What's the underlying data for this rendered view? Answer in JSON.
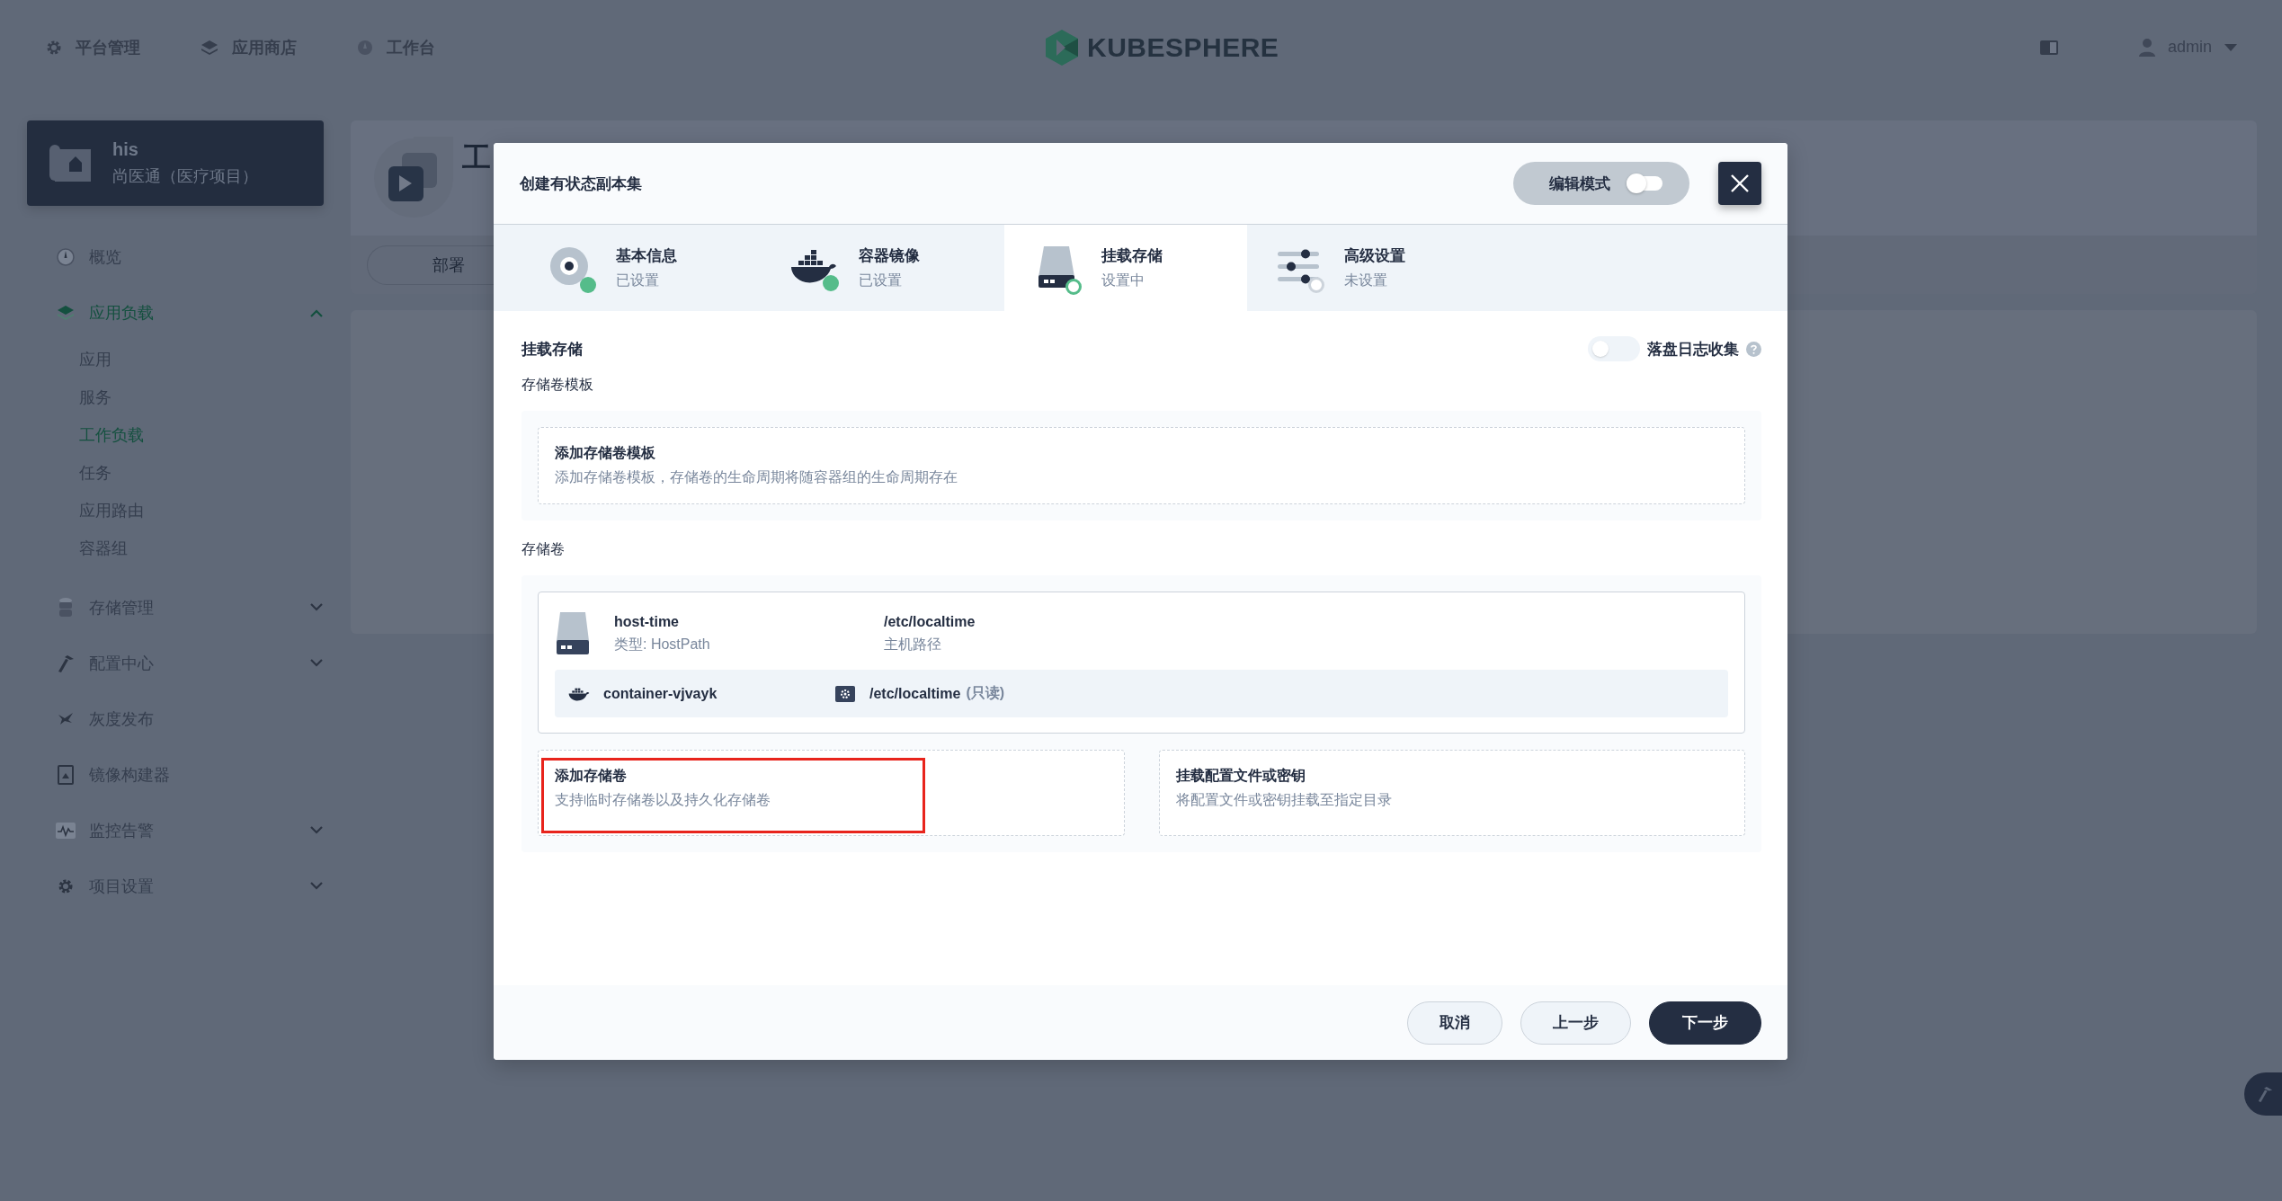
{
  "topbar": {
    "nav": [
      {
        "label": "平台管理"
      },
      {
        "label": "应用商店"
      },
      {
        "label": "工作台"
      }
    ],
    "logo": "KUBESPHERE",
    "user": "admin"
  },
  "project": {
    "name": "his",
    "description": "尚医通（医疗项目）"
  },
  "sidebar": {
    "items": [
      {
        "label": "概览",
        "kind": "link",
        "selected": false
      },
      {
        "label": "应用负载",
        "kind": "group",
        "expanded": true,
        "selected": true,
        "children": [
          {
            "label": "应用",
            "selected": false
          },
          {
            "label": "服务",
            "selected": false
          },
          {
            "label": "工作负载",
            "selected": true
          },
          {
            "label": "任务",
            "selected": false
          },
          {
            "label": "应用路由",
            "selected": false
          },
          {
            "label": "容器组",
            "selected": false
          }
        ]
      },
      {
        "label": "存储管理",
        "kind": "group",
        "expanded": false,
        "selected": false
      },
      {
        "label": "配置中心",
        "kind": "group",
        "expanded": false,
        "selected": false
      },
      {
        "label": "灰度发布",
        "kind": "link",
        "selected": false
      },
      {
        "label": "镜像构建器",
        "kind": "link",
        "selected": false
      },
      {
        "label": "监控告警",
        "kind": "group",
        "expanded": false,
        "selected": false
      },
      {
        "label": "项目设置",
        "kind": "group",
        "expanded": false,
        "selected": false
      }
    ]
  },
  "background": {
    "title": "工",
    "tab": "部署"
  },
  "dialog": {
    "title": "创建有状态副本集",
    "edit_mode": {
      "label": "编辑模式",
      "on": false
    },
    "steps": [
      {
        "title": "基本信息",
        "status": "已设置",
        "selected": false
      },
      {
        "title": "容器镜像",
        "status": "已设置",
        "selected": false
      },
      {
        "title": "挂载存储",
        "status": "设置中",
        "selected": true
      },
      {
        "title": "高级设置",
        "status": "未设置",
        "selected": false
      }
    ],
    "section_title": "挂载存储",
    "log_collection": {
      "label": "落盘日志收集",
      "on": false
    },
    "template_label": "存储卷模板",
    "template_card": {
      "title": "添加存储卷模板",
      "description": "添加存储卷模板，存储卷的生命周期将随容器组的生命周期存在"
    },
    "volumes_label": "存储卷",
    "volumes": [
      {
        "name": "host-time",
        "type": "类型: HostPath",
        "path": "/etc/localtime",
        "path_label": "主机路径",
        "mounts": [
          {
            "container": "container-vjvayk",
            "mount_path": "/etc/localtime",
            "mode": "(只读)"
          }
        ]
      }
    ],
    "actions": [
      {
        "title": "添加存储卷",
        "description": "支持临时存储卷以及持久化存储卷",
        "highlighted": true
      },
      {
        "title": "挂载配置文件或密钥",
        "description": "将配置文件或密钥挂载至指定目录",
        "highlighted": false
      }
    ],
    "buttons": [
      {
        "label": "取消",
        "kind": "secondary"
      },
      {
        "label": "上一步",
        "kind": "secondary"
      },
      {
        "label": "下一步",
        "kind": "primary"
      }
    ]
  }
}
